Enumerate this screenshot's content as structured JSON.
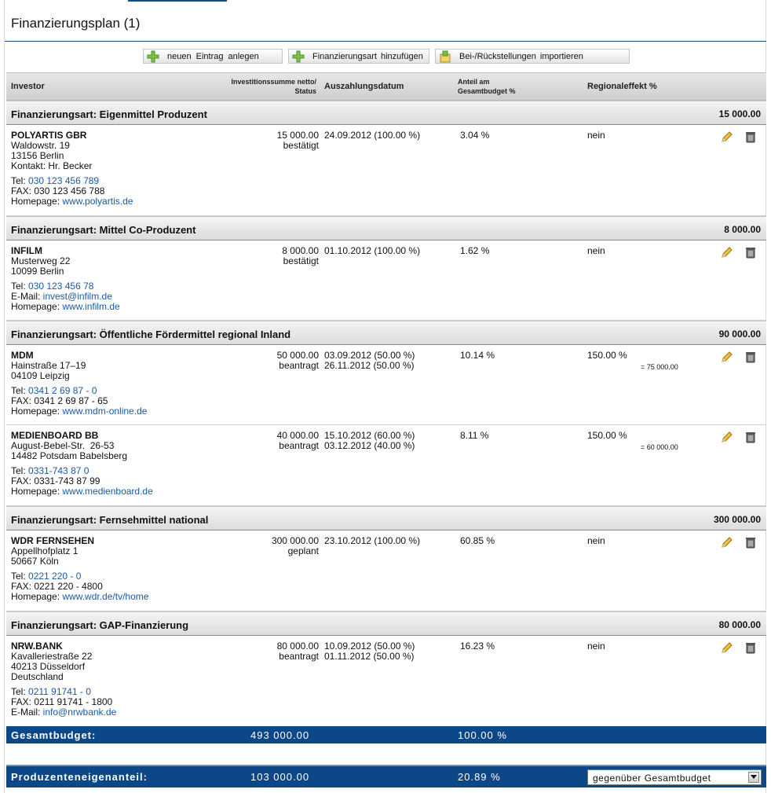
{
  "page": {
    "title": "Finanzierungsplan (1)"
  },
  "toolbar": {
    "new_entry": "neuen Eintrag anlegen",
    "add_type": "Finanzierungsart hinzufügen",
    "import": "Bei-/Rückstellungen importieren"
  },
  "table": {
    "headers": {
      "investor": "Investor",
      "amount_line1": "Investitionssumme netto/",
      "amount_line2": "Status",
      "date": "Auszahlungsdatum",
      "share_line1": "Anteil am",
      "share_line2": "Gesamtbudget %",
      "regional": "Regionaleffekt %"
    },
    "groups": [
      {
        "label": "Finanzierungsart: Eigenmittel Produzent",
        "total": "15 000.00"
      },
      {
        "label": "Finanzierungsart: Mittel Co-Produzent",
        "total": "8 000.00"
      },
      {
        "label": "Finanzierungsart: Öffentliche Fördermittel regional Inland",
        "total": "90 000.00"
      },
      {
        "label": "Finanzierungsart: Fernsehmittel national",
        "total": "300 000.00"
      },
      {
        "label": "Finanzierungsart: GAP-Finanzierung",
        "total": "80 000.00"
      }
    ],
    "rows": [
      {
        "name": "POLYARTIS GBR",
        "addr1": "Waldowstr. 19",
        "addr2": "13156 Berlin",
        "addr3": "Kontakt: Hr. Becker",
        "c1_label": "Tel: ",
        "c1_value": "030 123 456 789",
        "c2_label": "FAX: 030 123 456 788",
        "c3_label": "Homepage: ",
        "c3_value": "www.polyartis.de",
        "amount": "15 000.00",
        "status": "bestätigt",
        "date1": "24.09.2012 (100.00 %)",
        "share": "3.04 %",
        "regional": "nein"
      },
      {
        "name": "INFILM",
        "addr1": "Musterweg 22",
        "addr2": "10099 Berlin",
        "c1_label": "Tel: ",
        "c1_value": "030 123 456 78",
        "c2_label": "E-Mail: ",
        "c2_value": "invest@infilm.de",
        "c3_label": "Homepage: ",
        "c3_value": "www.infilm.de",
        "amount": "8 000.00",
        "status": "bestätigt",
        "date1": "01.10.2012 (100.00 %)",
        "share": "1.62 %",
        "regional": "nein"
      },
      {
        "name": "MDM",
        "addr1": "Hainstraße 17–19",
        "addr2": "04109 Leipzig",
        "c1_label": "Tel: ",
        "c1_value": "0341 2 69 87 - 0",
        "c2_label": "FAX: 0341 2 69 87 - 65",
        "c3_label": "Homepage: ",
        "c3_value": "www.mdm-online.de",
        "amount": "50 000.00",
        "status": "beantragt",
        "date1": "03.09.2012 (50.00 %)",
        "date2": "26.11.2012 (50.00 %)",
        "share": "10.14 %",
        "regional": "150.00 %",
        "regional_sub": "= 75 000.00"
      },
      {
        "name": "MEDIENBOARD BB",
        "addr1": "August-Bebel-Str.  26-53",
        "addr2": "14482 Potsdam Babelsberg",
        "c1_label": "Tel: ",
        "c1_value": "0331-743 87 0",
        "c2_label": "FAX: 0331-743 87 99",
        "c3_label": "Homepage: ",
        "c3_value": "www.medienboard.de",
        "amount": "40 000.00",
        "status": "beantragt",
        "date1": "15.10.2012 (60.00 %)",
        "date2": "03.12.2012 (40.00 %)",
        "share": "8.11 %",
        "regional": "150.00 %",
        "regional_sub": "= 60 000.00"
      },
      {
        "name": "WDR FERNSEHEN",
        "addr1": "Appellhofplatz 1",
        "addr2": "50667 Köln",
        "c1_label": "Tel: ",
        "c1_value": "0221 220 - 0",
        "c2_label": "FAX: 0221 220 - 4800",
        "c3_label": "Homepage: ",
        "c3_value": "www.wdr.de/tv/home",
        "amount": "300 000.00",
        "status": "geplant",
        "date1": "23.10.2012 (100.00 %)",
        "share": "60.85 %",
        "regional": "nein"
      },
      {
        "name": "NRW.BANK",
        "addr1": "Kavalleriestraße 22",
        "addr2": "40213 Düsseldorf",
        "addr3": "Deutschland",
        "c1_label": "Tel: ",
        "c1_value": "0211 91741 - 0",
        "c2_label": "FAX: 0211 91741 - 1800",
        "c3_label": "E-Mail: ",
        "c3_value": "info@nrwbank.de",
        "amount": "80 000.00",
        "status": "beantragt",
        "date1": "10.09.2012 (50.00 %)",
        "date2": "01.11.2012 (50.00 %)",
        "share": "16.23 %",
        "regional": "nein"
      }
    ]
  },
  "totals": {
    "budget_label": "Gesamtbudget:",
    "budget_value": "493 000.00",
    "budget_share": "100.00 %",
    "producer_label": "Produzenteneigenanteil:",
    "producer_value": "103 000.00",
    "producer_share": "20.89 %",
    "select_value": "gegenüber Gesamtbudget"
  },
  "colors": {
    "accent": "#0c4787",
    "link": "#1a5aa6"
  },
  "icons": {
    "add": "plus-icon",
    "import": "import-icon",
    "edit": "pencil-icon",
    "delete": "trash-icon",
    "dropdown": "chevron-down-icon"
  }
}
